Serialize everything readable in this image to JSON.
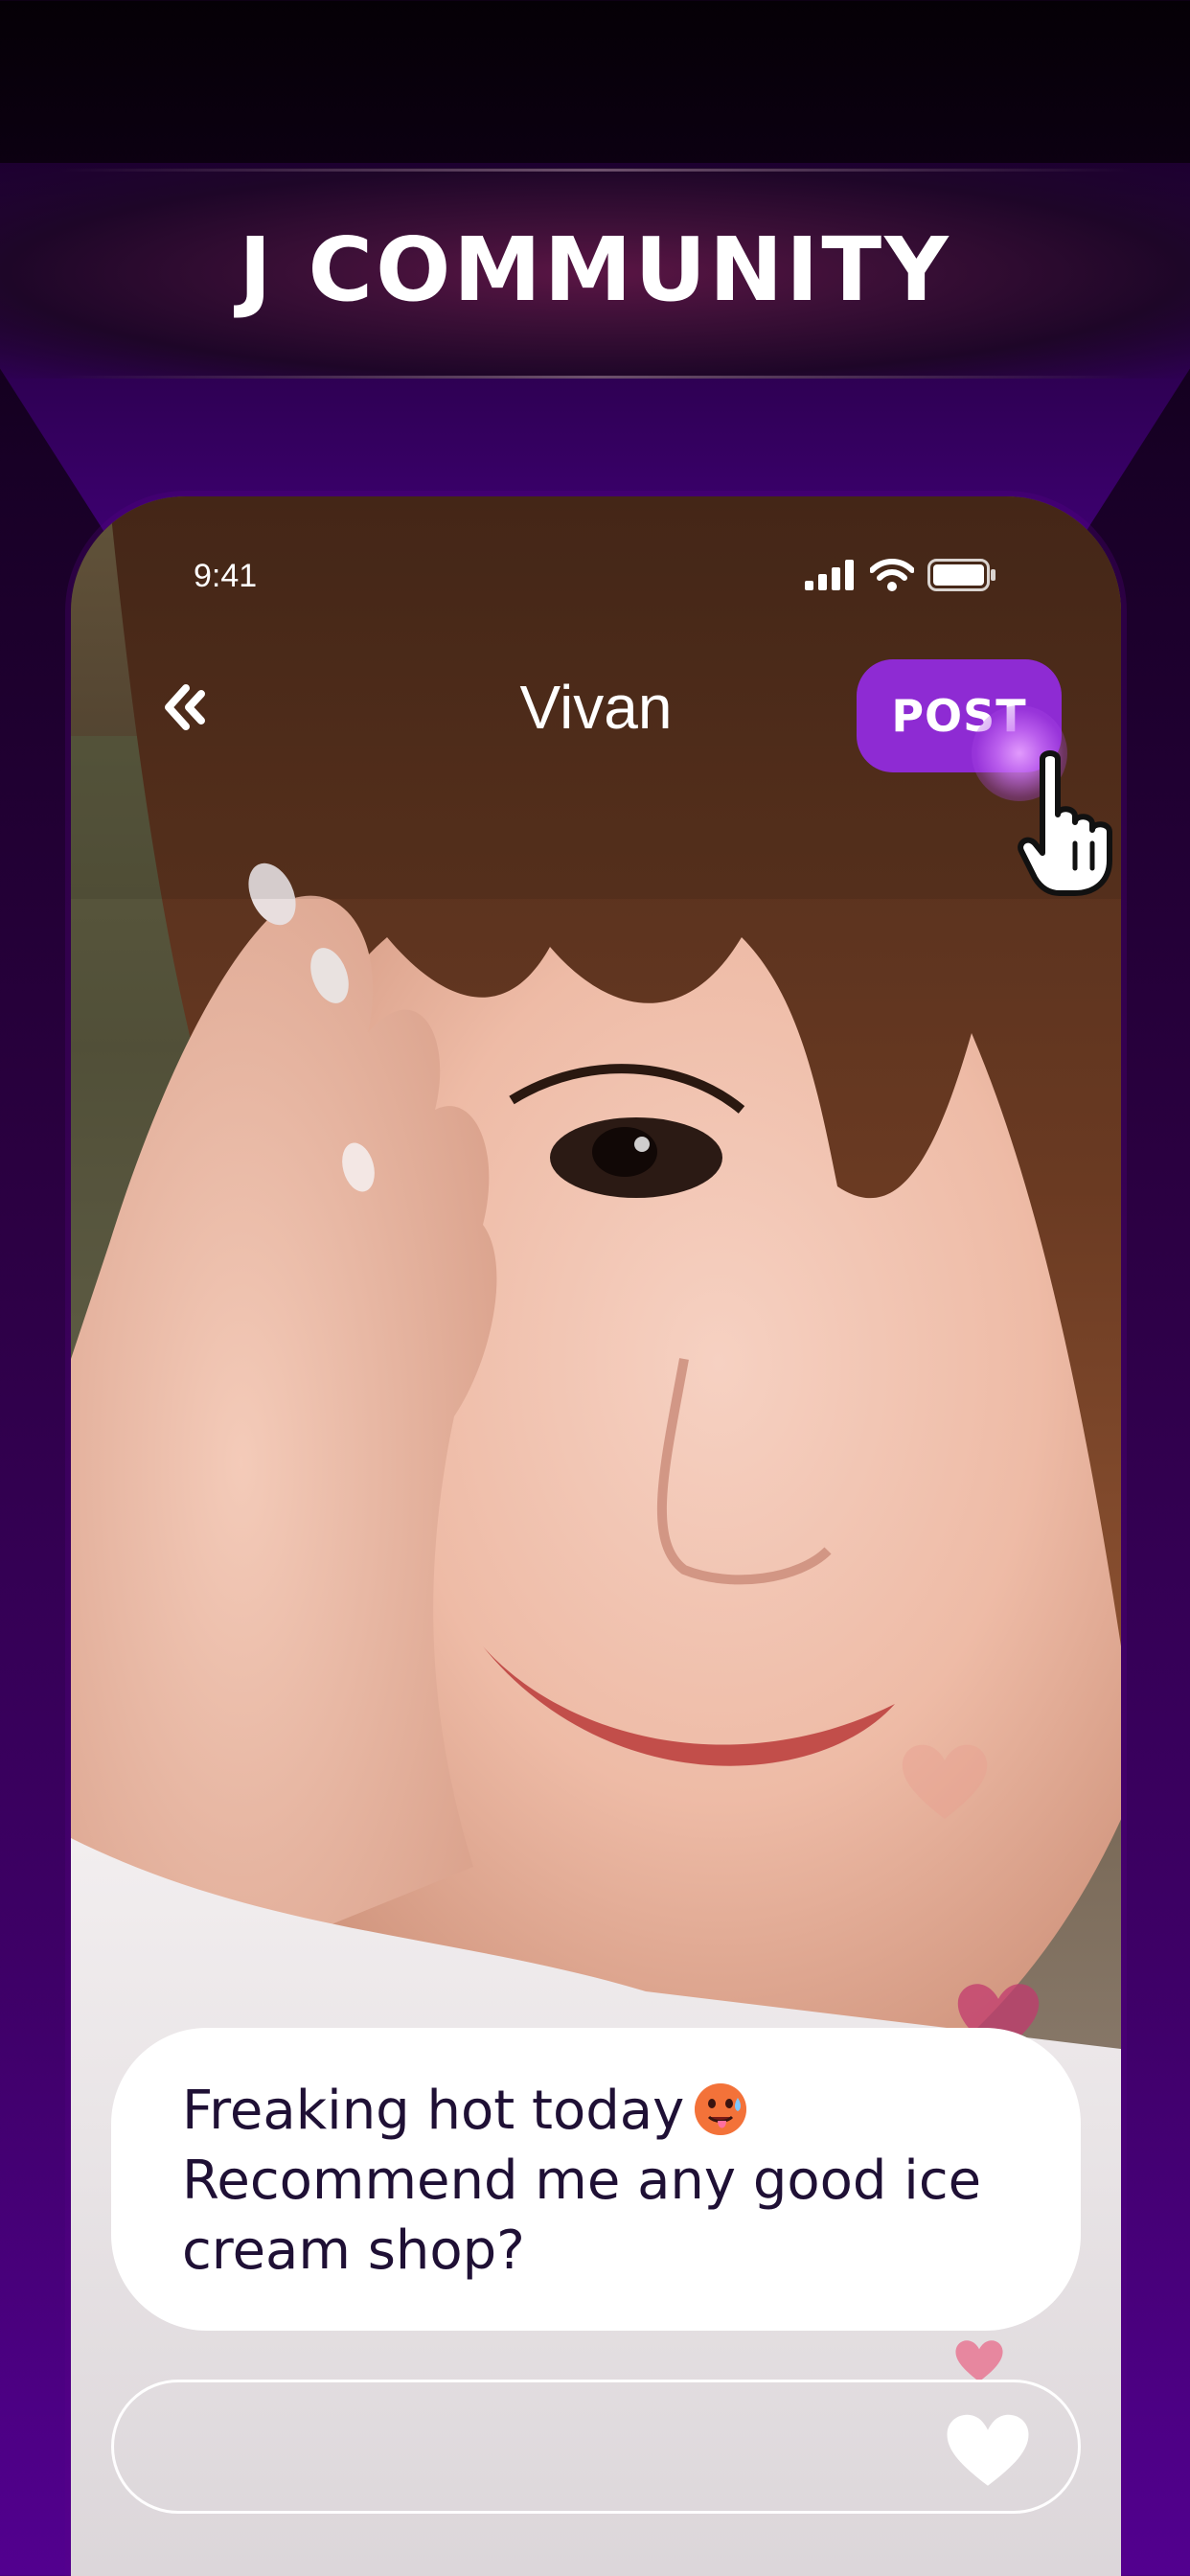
{
  "banner": {
    "title": "J COMMUNITY"
  },
  "status_bar": {
    "time": "9:41"
  },
  "nav": {
    "title": "Vivan",
    "post_label": "POST"
  },
  "post": {
    "caption_line1": "Freaking hot today",
    "caption_line2": "Recommend me any good ice",
    "caption_line3": "cream shop?",
    "emoji": "hot-face-emoji"
  },
  "comment": {
    "placeholder": ""
  },
  "icons": {
    "back": "double-chevron-left-icon",
    "signal": "cellular-signal-icon",
    "wifi": "wifi-icon",
    "battery": "battery-icon",
    "like": "heart-icon",
    "cursor": "hand-pointer-icon"
  },
  "colors": {
    "accent": "#8e2bd3",
    "background_top": "#050006",
    "background_bottom": "#52008f",
    "caption_text": "#1f1035"
  }
}
